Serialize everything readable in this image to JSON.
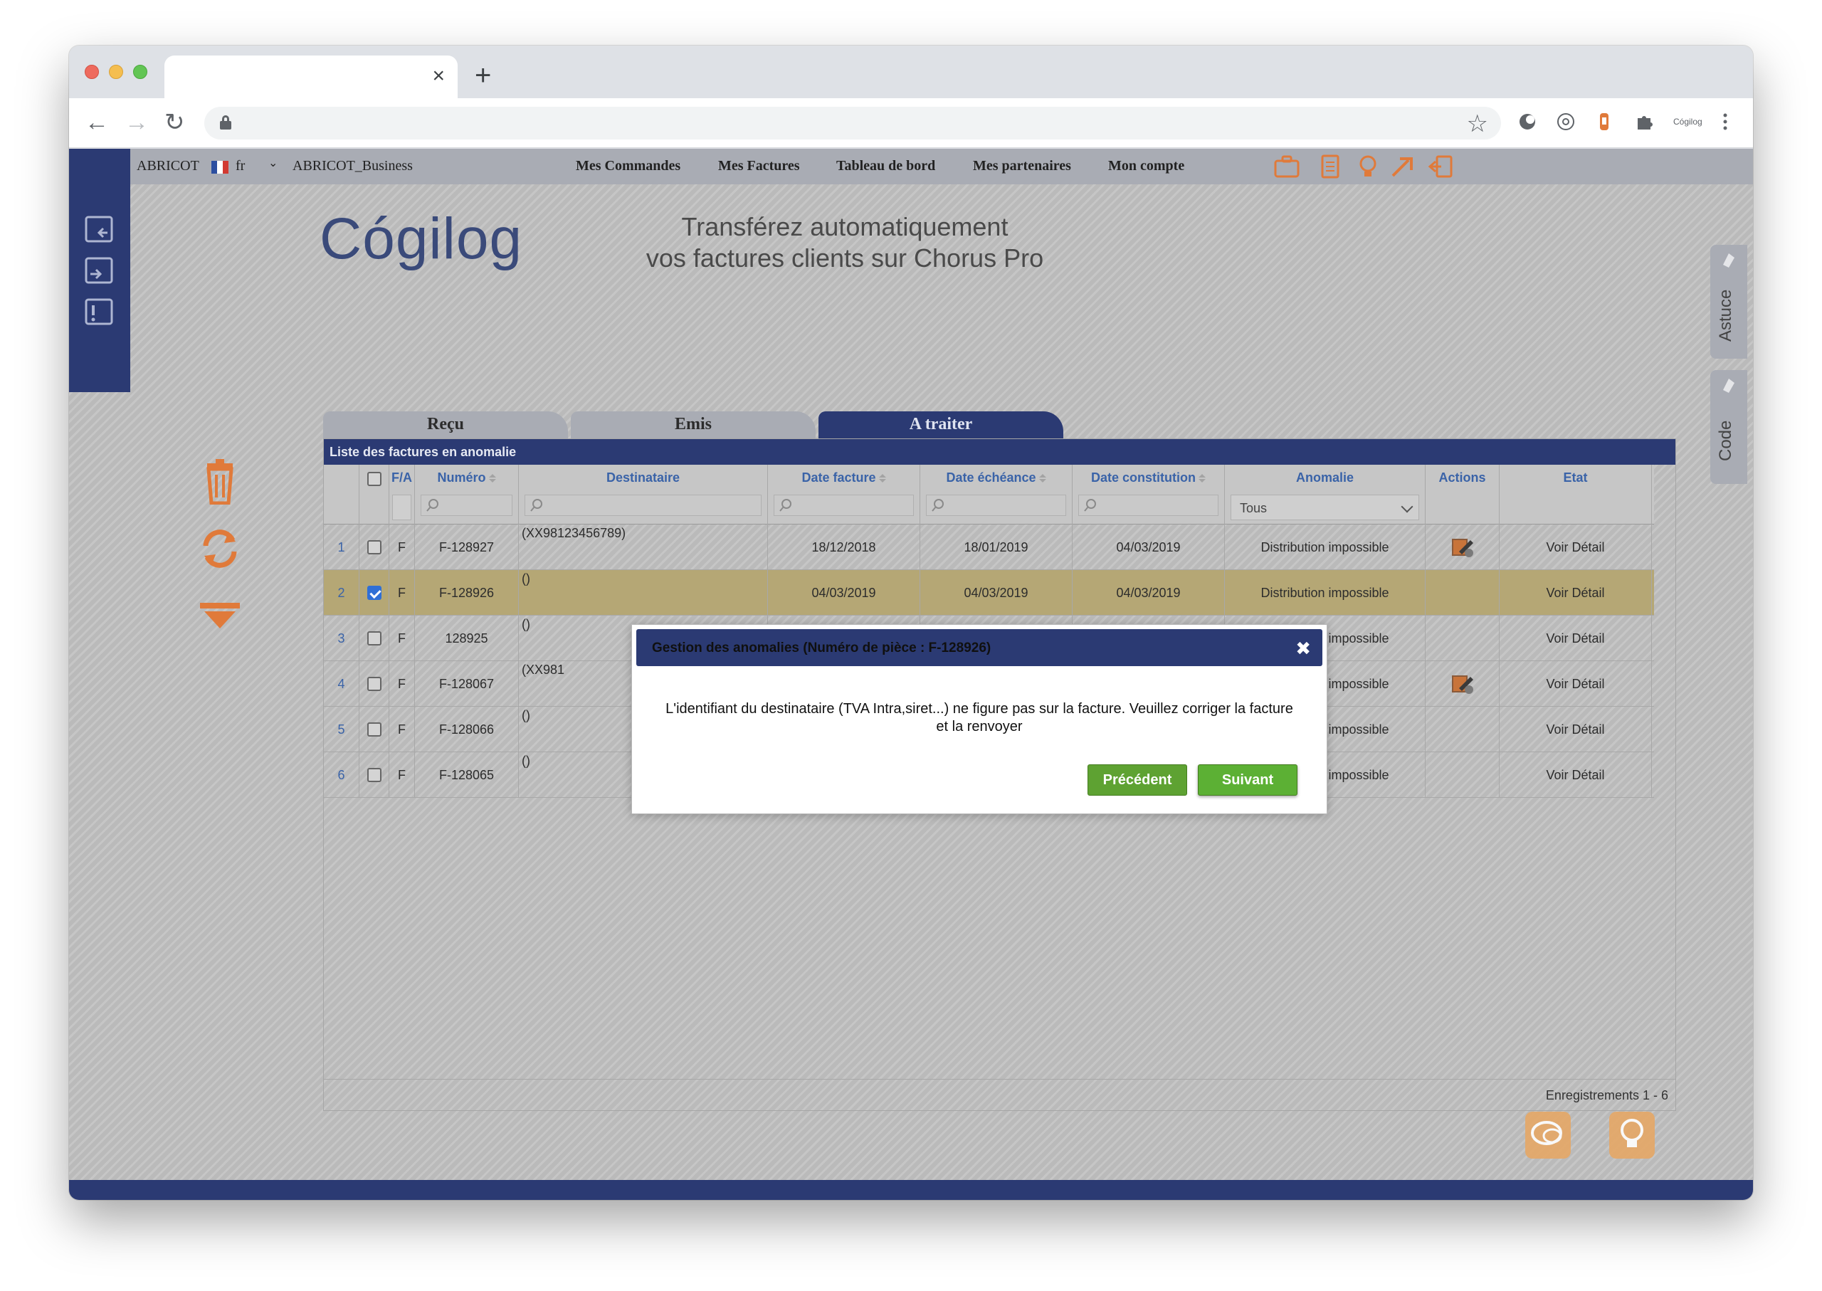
{
  "browser": {
    "new_tab_symbol": "+",
    "close_tab_symbol": "×",
    "profile_text": "Cógilog"
  },
  "app": {
    "company": "ABRICOT",
    "language": "fr",
    "account": "ABRICOT_Business",
    "menu": [
      "Mes Commandes",
      "Mes Factures",
      "Tableau de bord",
      "Mes partenaires",
      "Mon compte"
    ],
    "brand": "Cógilog",
    "headline_line1": "Transférez automatiquement",
    "headline_line2": "vos factures clients sur Chorus Pro",
    "side_tabs": [
      "Astuce",
      "Code"
    ]
  },
  "tabs": [
    {
      "label": "Reçu",
      "active": false
    },
    {
      "label": "Emis",
      "active": false
    },
    {
      "label": "A traiter",
      "active": true
    }
  ],
  "grid": {
    "caption": "Liste des factures en anomalie",
    "columns": {
      "fa": "F/A",
      "numero": "Numéro",
      "destinataire": "Destinataire",
      "date_facture": "Date facture",
      "date_echeance": "Date échéance",
      "date_constitution": "Date constitution",
      "anomalie": "Anomalie",
      "actions": "Actions",
      "etat": "Etat"
    },
    "anomalie_filter": "Tous",
    "rows": [
      {
        "n": "1",
        "fa": "F",
        "numero": "F-128927",
        "dest": "(XX98123456789)",
        "date_facture": "18/12/2018",
        "date_echeance": "18/01/2019",
        "date_constitution": "04/03/2019",
        "anomalie": "Distribution impossible",
        "etat": "Voir Détail",
        "checked": false
      },
      {
        "n": "2",
        "fa": "F",
        "numero": "F-128926",
        "dest": "()",
        "date_facture": "04/03/2019",
        "date_echeance": "04/03/2019",
        "date_constitution": "04/03/2019",
        "anomalie": "Distribution impossible",
        "etat": "Voir Détail",
        "checked": true
      },
      {
        "n": "3",
        "fa": "F",
        "numero": "128925",
        "dest": "()",
        "date_facture": "",
        "date_echeance": "",
        "date_constitution": "",
        "anomalie": "Distribution impossible",
        "etat": "Voir Détail",
        "checked": false
      },
      {
        "n": "4",
        "fa": "F",
        "numero": "F-128067",
        "dest": "(XX981",
        "date_facture": "",
        "date_echeance": "",
        "date_constitution": "",
        "anomalie": "Distribution impossible",
        "etat": "Voir Détail",
        "checked": false
      },
      {
        "n": "5",
        "fa": "F",
        "numero": "F-128066",
        "dest": "()",
        "date_facture": "",
        "date_echeance": "",
        "date_constitution": "",
        "anomalie": "Distribution impossible",
        "etat": "Voir Détail",
        "checked": false
      },
      {
        "n": "6",
        "fa": "F",
        "numero": "F-128065",
        "dest": "()",
        "date_facture": "",
        "date_echeance": "",
        "date_constitution": "",
        "anomalie": "Distribution impossible",
        "etat": "Voir Détail",
        "checked": false
      }
    ],
    "footer": "Enregistrements 1 - 6"
  },
  "modal": {
    "title": "Gestion des anomalies (Numéro de pièce : F-128926)",
    "close": "✖",
    "message_line1": "L'identifiant du destinataire (TVA Intra,siret...) ne figure pas sur la facture. Veuillez corriger la facture",
    "message_line2": "et la renvoyer",
    "prev_label": "Précédent",
    "next_label": "Suivant"
  },
  "colors": {
    "navy": "#2b3a73",
    "accent_orange": "#e07a3a",
    "selected_row": "#b5a775",
    "button_green": "#5cb034"
  }
}
